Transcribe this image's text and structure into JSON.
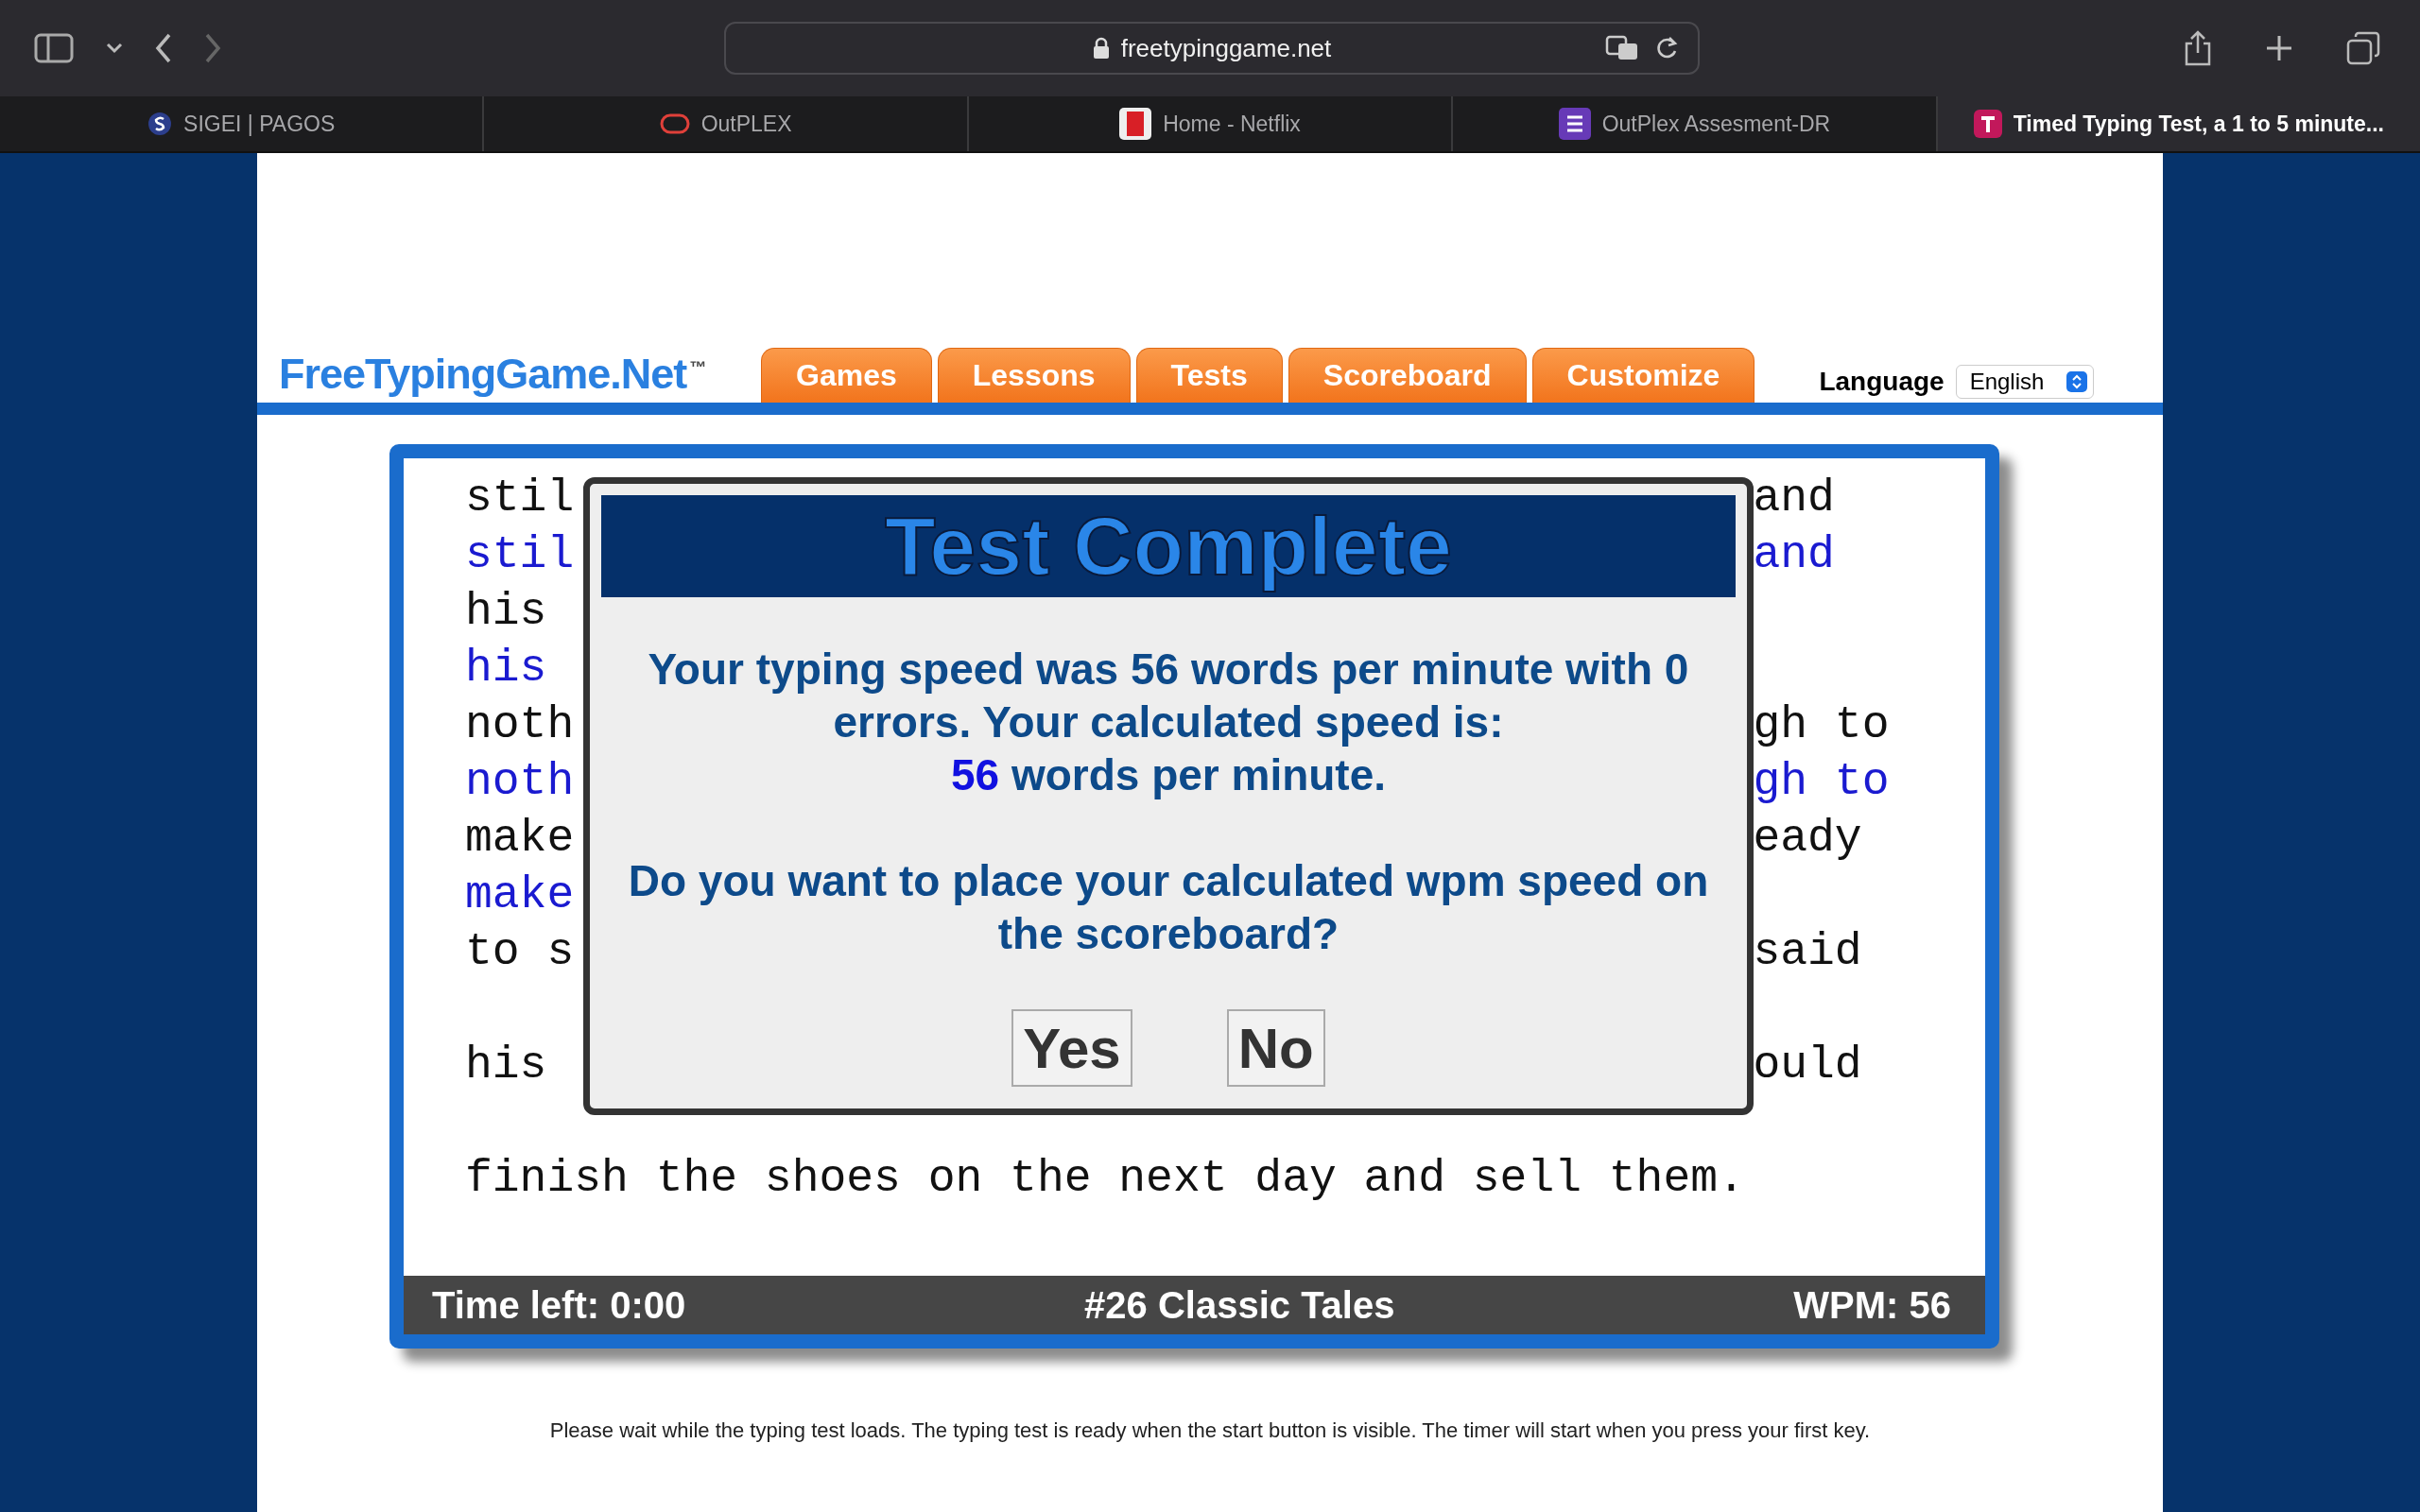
{
  "browser": {
    "address": "freetypinggame.net",
    "tabs": [
      {
        "title": "SIGEI | PAGOS",
        "kind": "s-circle",
        "selected": false
      },
      {
        "title": "OutPLEX",
        "kind": "ring",
        "selected": false
      },
      {
        "title": "Home - Netflix",
        "kind": "red-tile",
        "selected": false
      },
      {
        "title": "OutPlex Assesment-DR",
        "kind": "list-tile",
        "selected": false
      },
      {
        "title": "Timed Typing Test, a 1 to 5 minute...",
        "kind": "pink-tile",
        "selected": true
      }
    ]
  },
  "site": {
    "logo": "FreeTypingGame.Net$^{™}$",
    "nav": [
      "Games",
      "Lessons",
      "Tests",
      "Scoreboard",
      "Customize"
    ],
    "language_label": "Language",
    "language": "English"
  },
  "typing_text": {
    "lines": [
      {
        "kind": "source",
        "left": "stil",
        "right": "and"
      },
      {
        "kind": "typed",
        "left": "stil",
        "right": "and"
      },
      {
        "kind": "source",
        "left": "his"
      },
      {
        "kind": "typed",
        "left": "his"
      },
      {
        "kind": "source",
        "left": "noth",
        "right": "gh to"
      },
      {
        "kind": "typed",
        "left": "noth",
        "right": "gh to"
      },
      {
        "kind": "source",
        "left": "make",
        "right": "eady"
      },
      {
        "kind": "typed",
        "left": "make"
      },
      {
        "kind": "source",
        "left": "to s",
        "right": "said"
      },
      {
        "kind": "blank"
      },
      {
        "kind": "source",
        "left": "his",
        "right": "ould"
      },
      {
        "kind": "blank"
      },
      {
        "kind": "source",
        "left": "finish the shoes on the next day and sell them."
      }
    ]
  },
  "status_bar": {
    "time_left": "Time left: 0:00",
    "test_name": "#26 Classic Tales",
    "wpm": "WPM: 56"
  },
  "dialog": {
    "title": "Test Complete",
    "message": "Your typing speed was 56 words per minute with 0 errors. Your calculated speed is:",
    "calculated_speed": "56",
    "speed_unit": "words per minute.",
    "question": "Do you want to place your calculated wpm speed on the scoreboard?",
    "buttons": [
      "Yes",
      "No"
    ]
  },
  "footer_note": "Please wait while the typing test loads. The typing test is ready when the start button is visible. The timer will start when you press your first key."
}
